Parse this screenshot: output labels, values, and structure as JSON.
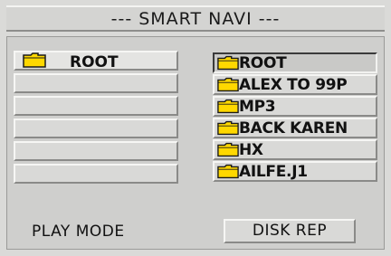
{
  "header": {
    "title": "--- SMART NAVI ---"
  },
  "left_list": {
    "items": [
      {
        "label": "ROOT",
        "icon": "folder-icon"
      },
      {
        "label": ""
      },
      {
        "label": ""
      },
      {
        "label": ""
      },
      {
        "label": ""
      },
      {
        "label": ""
      }
    ]
  },
  "right_list": {
    "items": [
      {
        "label": "ROOT",
        "icon": "folder-icon",
        "selected": true
      },
      {
        "label": "ALEX TO 99P",
        "icon": "folder-icon"
      },
      {
        "label": "MP3",
        "icon": "folder-icon"
      },
      {
        "label": "BACK KAREN",
        "icon": "folder-icon"
      },
      {
        "label": "HX",
        "icon": "folder-icon"
      },
      {
        "label": "AILFE.J1",
        "icon": "folder-icon"
      }
    ]
  },
  "footer": {
    "mode_label": "PLAY MODE",
    "disk_button_label": "DISK REP"
  },
  "colors": {
    "folder_fill": "#ffd800",
    "folder_outline": "#1a1a1a"
  }
}
